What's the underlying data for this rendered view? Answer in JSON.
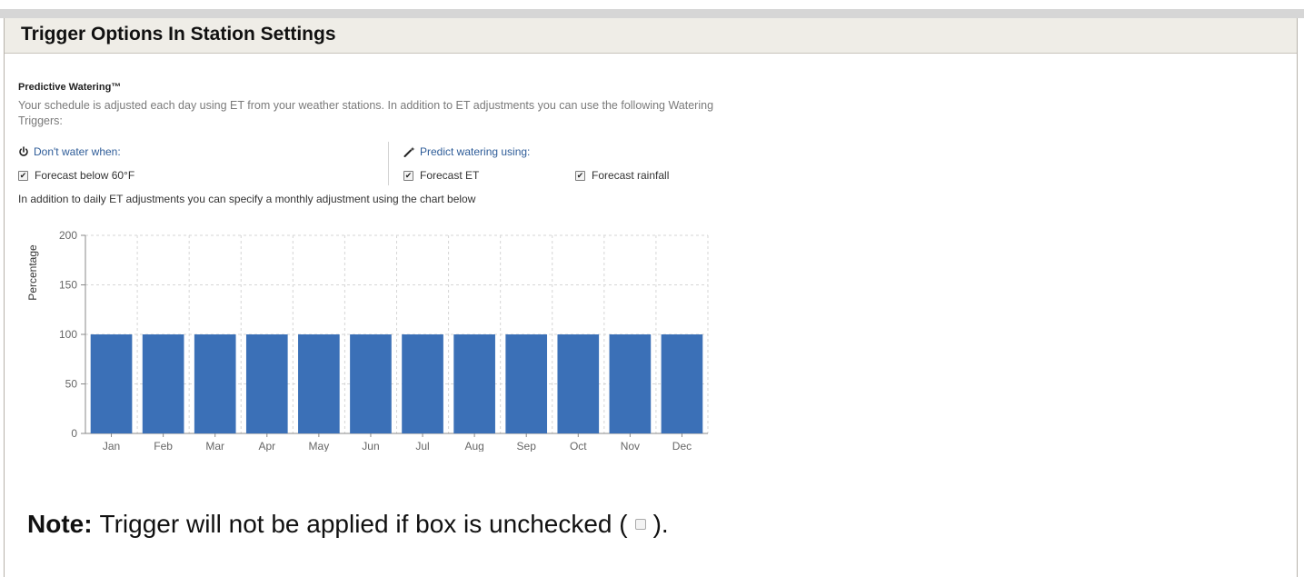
{
  "panel": {
    "title": "Trigger Options In Station Settings"
  },
  "predictive": {
    "title": "Predictive Watering™",
    "description": "Your schedule is adjusted each day using ET from your weather stations. In addition to ET adjustments you can use the following Watering Triggers:",
    "dont_water": {
      "heading": "Don't water when:",
      "icon": "power-icon",
      "options": [
        {
          "label": "Forecast below 60°F",
          "checked": true
        }
      ]
    },
    "predict": {
      "heading": "Predict watering using:",
      "icon": "magic-wand-icon",
      "options": [
        {
          "label": "Forecast ET",
          "checked": true
        },
        {
          "label": "Forecast rainfall",
          "checked": true
        }
      ]
    },
    "monthly_text": "In addition to daily ET adjustments you can specify a monthly adjustment using the chart below"
  },
  "chart_data": {
    "type": "bar",
    "categories": [
      "Jan",
      "Feb",
      "Mar",
      "Apr",
      "May",
      "Jun",
      "Jul",
      "Aug",
      "Sep",
      "Oct",
      "Nov",
      "Dec"
    ],
    "values": [
      100,
      100,
      100,
      100,
      100,
      100,
      100,
      100,
      100,
      100,
      100,
      100
    ],
    "ylabel": "Percentage",
    "ylim": [
      0,
      200
    ],
    "yticks": [
      0,
      50,
      100,
      150,
      200
    ],
    "grid": true,
    "bar_color": "#3b70b7"
  },
  "note": {
    "bold": "Note:",
    "text_before": "Trigger will not be applied if box is unchecked (",
    "text_after": ")."
  }
}
